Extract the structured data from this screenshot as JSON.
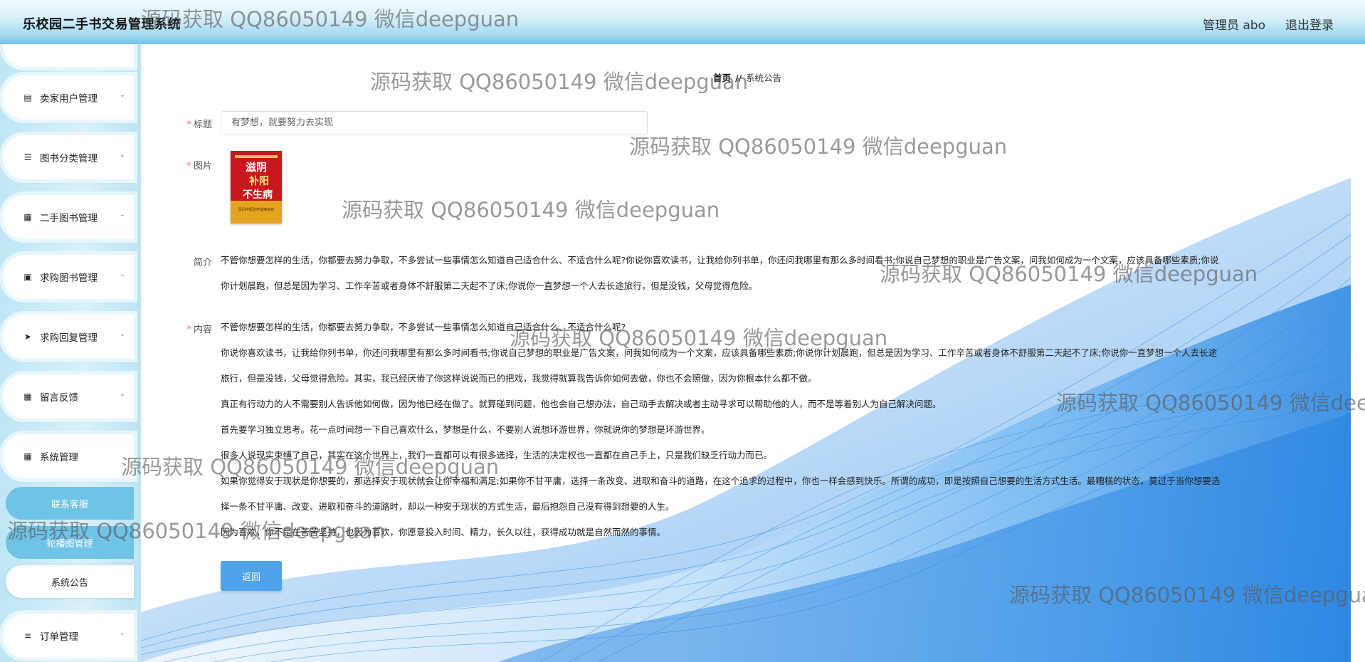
{
  "app": {
    "title": "乐校园二手书交易管理系统"
  },
  "header": {
    "user_label": "管理员 abo",
    "logout_label": "退出登录"
  },
  "sidebar": {
    "items": [
      {
        "label": "卖家用户管理",
        "icon": "chart-icon"
      },
      {
        "label": "图书分类管理",
        "icon": "list-icon"
      },
      {
        "label": "二手图书管理",
        "icon": "grid-icon"
      },
      {
        "label": "求购图书管理",
        "icon": "book-icon"
      },
      {
        "label": "求购回复管理",
        "icon": "send-icon"
      },
      {
        "label": "留言反馈",
        "icon": "grid-icon"
      },
      {
        "label": "系统管理",
        "icon": "grid-icon"
      },
      {
        "label": "订单管理",
        "icon": "sliders-icon"
      }
    ],
    "submenu": [
      "联系客服",
      "轮播图管理",
      "系统公告"
    ]
  },
  "breadcrumb": {
    "home": "首页",
    "sep": "//",
    "current": "系统公告"
  },
  "form": {
    "title_label": "标题",
    "title_value": "有梦想，就要努力去实现",
    "image_label": "图片",
    "cover": {
      "top": "滋阴",
      "mid": "补阳",
      "bottom": "不生病",
      "sub": "民间中医治疗疑难杂症"
    },
    "intro_label": "简介",
    "intro_lines": [
      "不管你想要怎样的生活，你都要去努力争取，不多尝试一些事情怎么知道自己适合什么、不适合什么呢?你说你喜欢读书，让我给你列书单，你还问我哪里有那么多时间看书;你说自己梦想的职业是广告文案，问我如何成为一个文案，应该具备哪些素质;你说",
      "你计划晨跑，但总是因为学习、工作辛苦或者身体不舒服第二天起不了床;你说你一直梦想一个人去长途旅行，但是没钱，父母觉得危险。"
    ],
    "content_label": "内容",
    "content_lines": [
      "不管你想要怎样的生活，你都要去努力争取，不多尝试一些事情怎么知道自己适合什么、不适合什么呢?",
      "你说你喜欢读书，让我给你列书单，你还问我哪里有那么多时间看书;你说自己梦想的职业是广告文案，问我如何成为一个文案，应该具备哪些素质;你说你计划晨跑，但总是因为学习、工作辛苦或者身体不舒服第二天起不了床;你说你一直梦想一个人去长途",
      "旅行，但是没钱，父母觉得危险。其实，我已经厌倦了你这样说说而已的把戏，我觉得就算我告诉你如何去做，你也不会照做，因为你根本什么都不做。",
      "真正有行动力的人不需要别人告诉他如何做，因为他已经在做了。就算碰到问题，他也会自己想办法，自己动手去解决或者主动寻求可以帮助他的人，而不是等着别人为自己解决问题。",
      "首先要学习独立思考。花一点时间想一下自己喜欢什么，梦想是什么，不要别人说想环游世界，你就说你的梦想是环游世界。",
      "很多人说现实束缚了自己，其实在这个世界上，我们一直都可以有很多选择，生活的决定权也一直都在自己手上，只是我们缺乏行动力而已。",
      "如果你觉得安于现状是你想要的，那选择安于现状就会让你幸福和满足;如果你不甘平庸，选择一条改变、进取和奋斗的道路，在这个追求的过程中，你也一样会感到快乐。所谓的成功，即是按照自己想要的生活方式生活。最糟糕的状态，莫过于当你想要选",
      "择一条不甘平庸、改变、进取和奋斗的道路时，却以一种安于现状的方式生活，最后抱怨自己没有得到想要的人生。",
      "因为喜欢，你不是在苦苦坚持，也因为喜欢，你愿意投入时间、精力，长久以往，获得成功就是自然而然的事情。"
    ],
    "back_label": "返回"
  },
  "watermark": "源码获取 QQ86050149 微信deepguan"
}
